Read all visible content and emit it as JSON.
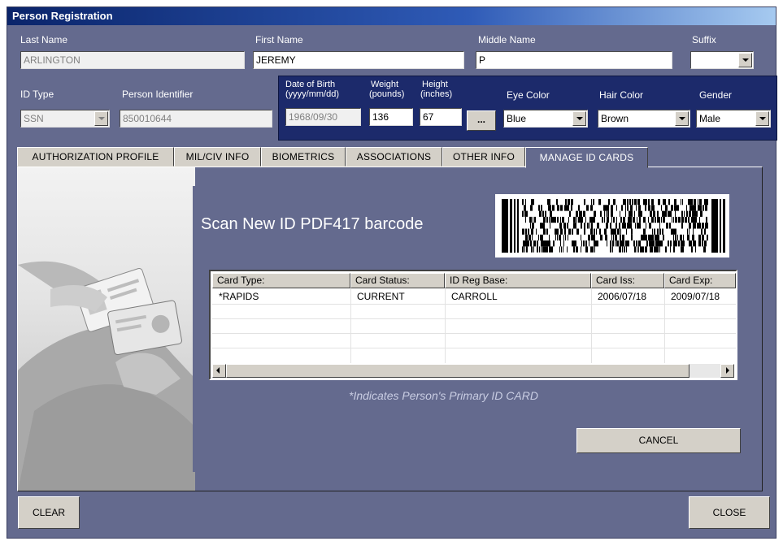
{
  "window": {
    "title": "Person Registration"
  },
  "fields": {
    "last_name": {
      "label": "Last Name",
      "value": "ARLINGTON"
    },
    "first_name": {
      "label": "First Name",
      "value": "JEREMY"
    },
    "middle_name": {
      "label": "Middle Name",
      "value": "P"
    },
    "suffix": {
      "label": "Suffix",
      "value": ""
    },
    "id_type": {
      "label": "ID Type",
      "value": "SSN"
    },
    "person_identifier": {
      "label": "Person Identifier",
      "value": "850010644"
    },
    "dob": {
      "label_line1": "Date of Birth",
      "label_line2": "(yyyy/mm/dd)",
      "value": "1968/09/30"
    },
    "weight": {
      "label_line1": "Weight",
      "label_line2": "(pounds)",
      "value": "136"
    },
    "height": {
      "label_line1": "Height",
      "label_line2": "(inches)",
      "value": "67"
    },
    "more_button": "...",
    "eye_color": {
      "label": "Eye Color",
      "value": "Blue"
    },
    "hair_color": {
      "label": "Hair Color",
      "value": "Brown"
    },
    "gender": {
      "label": "Gender",
      "value": "Male"
    }
  },
  "tabs": [
    {
      "label": "AUTHORIZATION PROFILE",
      "active": false
    },
    {
      "label": "MIL/CIV INFO",
      "active": false
    },
    {
      "label": "BIOMETRICS",
      "active": false
    },
    {
      "label": "ASSOCIATIONS",
      "active": false
    },
    {
      "label": "OTHER INFO",
      "active": false
    },
    {
      "label": "MANAGE ID CARDS",
      "active": true
    }
  ],
  "manage_cards": {
    "scan_prompt": "Scan New ID PDF417 barcode",
    "columns": [
      "Card Type:",
      "Card Status:",
      "ID Reg Base:",
      "Card Iss:",
      "Card Exp:"
    ],
    "rows": [
      [
        "*RAPIDS",
        "CURRENT",
        "CARROLL",
        "2006/07/18",
        "2009/07/18"
      ]
    ],
    "note": "*Indicates Person's Primary ID CARD",
    "cancel_label": "CANCEL"
  },
  "footer": {
    "clear_label": "CLEAR",
    "close_label": "CLOSE"
  },
  "colors": {
    "window_bg": "#646a8e",
    "title_bar": "#0a246a",
    "navy_strip": "#1c2a6b"
  }
}
